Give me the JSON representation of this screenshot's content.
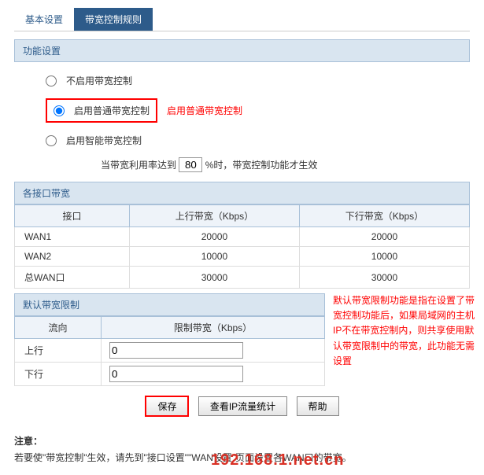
{
  "tabs": {
    "basic": "基本设置",
    "rules": "带宽控制规则"
  },
  "function_section": {
    "title": "功能设置",
    "opt_disable": "不启用带宽控制",
    "opt_normal": "启用普通带宽控制",
    "opt_smart": "启用智能带宽控制",
    "normal_annotation": "启用普通带宽控制",
    "util_prefix": "当带宽利用率达到",
    "util_value": "80",
    "util_suffix": "%时，带宽控制功能才生效"
  },
  "port_section": {
    "title": "各接口带宽",
    "col_port": "接口",
    "col_up": "上行带宽（Kbps）",
    "col_down": "下行带宽（Kbps）",
    "rows": [
      {
        "port": "WAN1",
        "up": "20000",
        "down": "20000"
      },
      {
        "port": "WAN2",
        "up": "10000",
        "down": "10000"
      },
      {
        "port": "总WAN口",
        "up": "30000",
        "down": "30000"
      }
    ]
  },
  "limit_section": {
    "title": "默认带宽限制",
    "col_dir": "流向",
    "col_limit": "限制带宽（Kbps）",
    "rows": [
      {
        "dir": "上行",
        "val": "0"
      },
      {
        "dir": "下行",
        "val": "0"
      }
    ],
    "annotation": "默认带宽限制功能是指在设置了带宽控制功能后，如果局域网的主机IP不在带宽控制内，则共享使用默认带宽限制中的带宽，此功能无需设置"
  },
  "buttons": {
    "save": "保存",
    "stats": "查看IP流量统计",
    "help": "帮助"
  },
  "note": {
    "title": "注意：",
    "text_prefix": "若要使\"带宽控制\"生效，请先到\"接口设置\"",
    "text_mid": "\"WAN设置\"页面设置各WAN口的带宽。",
    "watermark": "192.168.1.net.cn"
  }
}
